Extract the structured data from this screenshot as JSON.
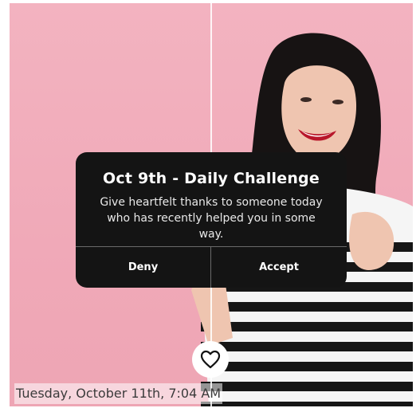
{
  "challenge": {
    "title": "Oct 9th - Daily Challenge",
    "body": "Give heartfelt thanks to someone today who has recently helped you in some way.",
    "deny_label": "Deny",
    "accept_label": "Accept"
  },
  "timestamp": "Tuesday, October 11th, 7:04 AM",
  "icons": {
    "like": "heart-icon"
  },
  "colors": {
    "background": "#f0a9b8",
    "card": "#141414"
  }
}
